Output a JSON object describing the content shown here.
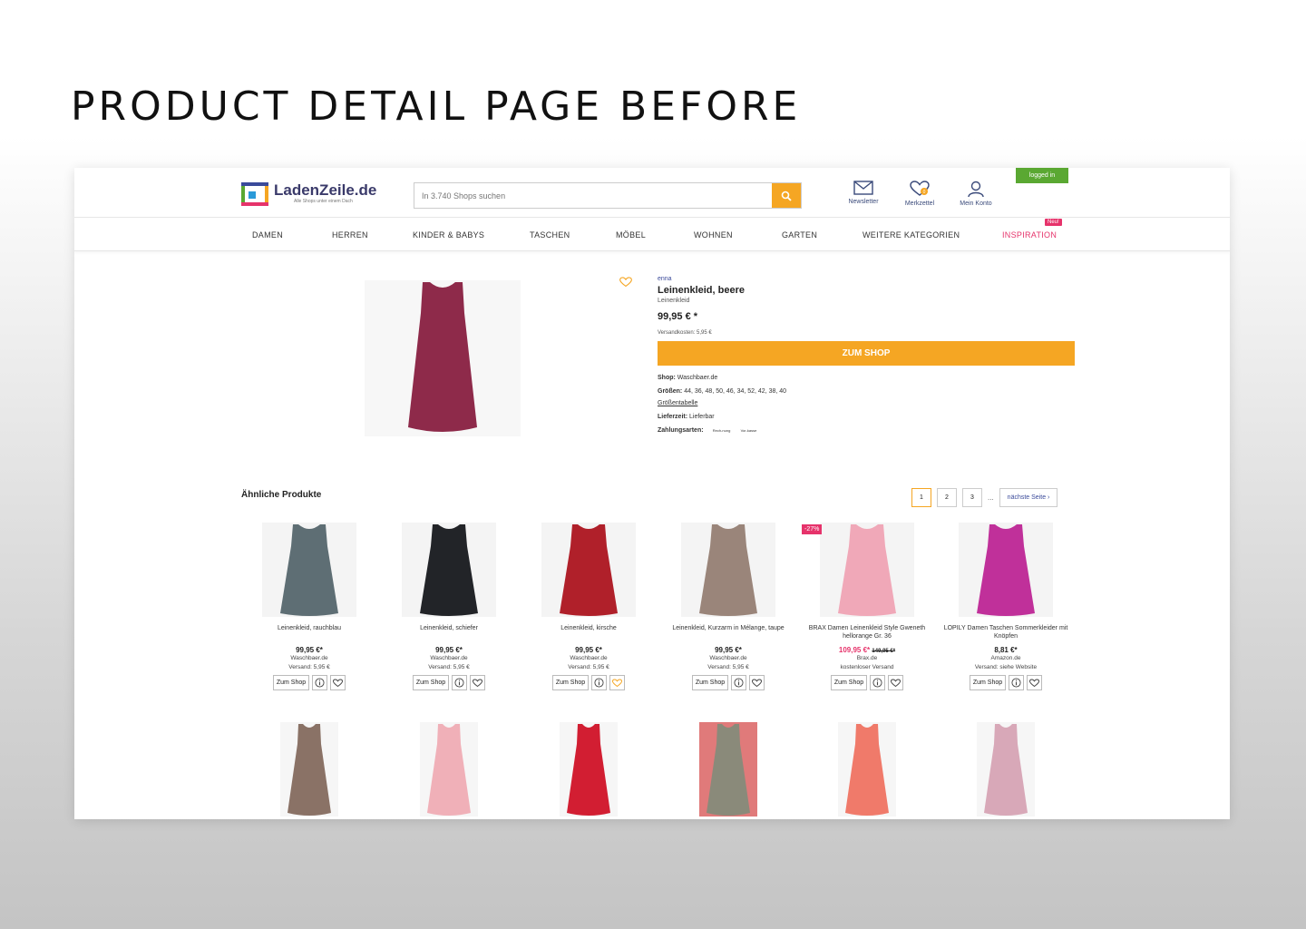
{
  "heading": "PRODUCT DETAIL PAGE BEFORE",
  "header": {
    "logo_name": "LadenZeile.de",
    "logo_tagline": "Alle Shops unter einem Dach",
    "search_placeholder": "In 3.740 Shops suchen",
    "newsletter": "Newsletter",
    "merkzettel": "Merkzettel",
    "merkzettel_count": "0",
    "konto": "Mein Konto",
    "login_badge": "logged in"
  },
  "nav": {
    "items": [
      "DAMEN",
      "HERREN",
      "KINDER & BABYS",
      "TASCHEN",
      "MÖBEL",
      "WOHNEN",
      "GARTEN",
      "WEITERE KATEGORIEN",
      "INSPIRATION"
    ],
    "new_badge": "Neu!"
  },
  "product": {
    "brand": "enna",
    "title": "Leinenkleid, beere",
    "subtitle": "Leinenkleid",
    "price": "99,95 € *",
    "shipping": "Versandkosten: 5,95 €",
    "cta": "ZUM SHOP",
    "shop_label": "Shop:",
    "shop_value": "Waschbaer.de",
    "sizes_label": "Größen:",
    "sizes_value": "44, 36, 48, 50, 46, 34, 52, 42, 38, 40",
    "size_chart": "Größentabelle",
    "delivery_label": "Lieferzeit:",
    "delivery_value": "Lieferbar",
    "payment_label": "Zahlungsarten:",
    "payment_1": "Rech-nung",
    "payment_2": "Vor-kasse",
    "color": "#8e2a4a"
  },
  "similar": {
    "title": "Ähnliche Produkte",
    "pages": [
      "1",
      "2",
      "3"
    ],
    "dots": "...",
    "next": "nächste Seite",
    "products": [
      {
        "name": "Leinenkleid, rauchblau",
        "price": "99,95 €*",
        "shop": "Waschbaer.de",
        "ship": "Versand: 5,95 €",
        "color": "#5e6e74"
      },
      {
        "name": "Leinenkleid, schiefer",
        "price": "99,95 €*",
        "shop": "Waschbaer.de",
        "ship": "Versand: 5,95 €",
        "color": "#222428"
      },
      {
        "name": "Leinenkleid, kirsche",
        "price": "99,95 €*",
        "shop": "Waschbaer.de",
        "ship": "Versand: 5,95 €",
        "color": "#b0202a"
      },
      {
        "name": "Leinenkleid, Kurzarm in Mélange, taupe",
        "price": "99,95 €*",
        "shop": "Waschbaer.de",
        "ship": "Versand: 5,95 €",
        "color": "#9a857a"
      },
      {
        "name": "BRAX Damen Leinenkleid Style Gweneth hellorange Gr. 36",
        "price_now": "109,95 €*",
        "price_old": "149,95 €*",
        "shop": "Brax.de",
        "ship": "kostenloser Versand",
        "sale": "-27%",
        "color": "#f0a8b8"
      },
      {
        "name": "LOPILY Damen Taschen Sommerkleider mit Knöpfen",
        "price": "8,81 €*",
        "shop": "Amazon.de",
        "ship": "Versand: siehe Website",
        "color": "#c0309a"
      }
    ],
    "zum_shop": "Zum Shop",
    "row2_colors": [
      "#8a7266",
      "#f0b0b8",
      "#d21e32",
      "#8a8a7a",
      "#f07a6a",
      "#d8a8b8"
    ]
  }
}
